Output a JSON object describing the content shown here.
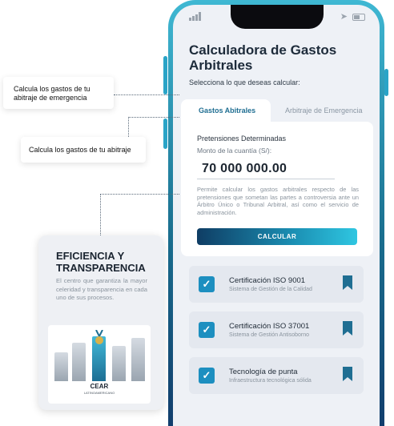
{
  "phone": {
    "title": "Calculadora de Gastos Arbitrales",
    "subtitle": "Selecciona lo que deseas calcular:",
    "tabs": [
      {
        "label": "Gastos Abitrales",
        "active": true
      },
      {
        "label": "Arbitraje de Emergencia",
        "active": false
      }
    ],
    "form": {
      "section_title": "Pretensiones Determinadas",
      "amount_label": "Monto de la cuantía (S/):",
      "amount_value": "70 000 000.00",
      "description": "Permite calcular los gastos arbitrales respecto de las pretensiones que sometan las partes a controversia ante un Árbitro Único o Tribunal Arbitral, así como el servicio de administración.",
      "button_label": "CALCULAR"
    },
    "features": [
      {
        "title": "Certificación ISO 9001",
        "subtitle": "Sistema de Gestión de la Calidad",
        "icon": "check-icon"
      },
      {
        "title": "Certificación ISO 37001",
        "subtitle": "Sistema de Gestión Antisoborno",
        "icon": "check-icon"
      },
      {
        "title": "Tecnología de punta",
        "subtitle": "Infraestructura tecnológica sólida",
        "icon": "check-icon"
      }
    ]
  },
  "callouts": {
    "emergency": "Calcula los gastos de tu abitraje de emergencia",
    "standard": "Calcula los gastos de tu abitraje"
  },
  "info_card": {
    "title": "EFICIENCIA Y TRANSPARENCIA",
    "body": "El centro que garantiza la mayor celeridad y transparencia en cada uno de sus procesos.",
    "logo_text": "CEAR",
    "logo_subtext": "LATINOAMERICANO"
  },
  "colors": {
    "accent": "#1f6e92",
    "button_gradient": [
      "#0f3d64",
      "#2fc6e1"
    ],
    "check": "#1d8fc0"
  }
}
